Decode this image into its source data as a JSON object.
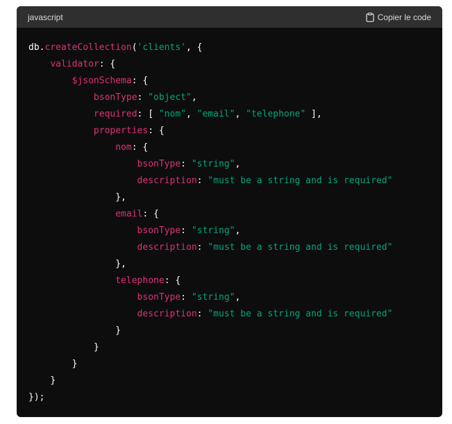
{
  "code_block": {
    "language": "javascript",
    "copy_label": "Copier le code",
    "colors": {
      "plain": "#ffffff",
      "keyword": "#df3079",
      "string": "#00a67d",
      "header_bg": "#2f2f2f",
      "body_bg": "#0d0d0d"
    },
    "lines": [
      [
        [
          "db.",
          "plain"
        ],
        [
          "createCollection",
          "keyword"
        ],
        [
          "(",
          "plain"
        ],
        [
          "'clients'",
          "string"
        ],
        [
          ", {",
          "plain"
        ]
      ],
      [
        [
          "    ",
          "plain"
        ],
        [
          "validator",
          "keyword"
        ],
        [
          ": {",
          "plain"
        ]
      ],
      [
        [
          "        ",
          "plain"
        ],
        [
          "$jsonSchema",
          "keyword"
        ],
        [
          ": {",
          "plain"
        ]
      ],
      [
        [
          "            ",
          "plain"
        ],
        [
          "bsonType",
          "keyword"
        ],
        [
          ": ",
          "plain"
        ],
        [
          "\"object\"",
          "string"
        ],
        [
          ",",
          "plain"
        ]
      ],
      [
        [
          "            ",
          "plain"
        ],
        [
          "required",
          "keyword"
        ],
        [
          ": [ ",
          "plain"
        ],
        [
          "\"nom\"",
          "string"
        ],
        [
          ", ",
          "plain"
        ],
        [
          "\"email\"",
          "string"
        ],
        [
          ", ",
          "plain"
        ],
        [
          "\"telephone\"",
          "string"
        ],
        [
          " ],",
          "plain"
        ]
      ],
      [
        [
          "            ",
          "plain"
        ],
        [
          "properties",
          "keyword"
        ],
        [
          ": {",
          "plain"
        ]
      ],
      [
        [
          "                ",
          "plain"
        ],
        [
          "nom",
          "keyword"
        ],
        [
          ": {",
          "plain"
        ]
      ],
      [
        [
          "                    ",
          "plain"
        ],
        [
          "bsonType",
          "keyword"
        ],
        [
          ": ",
          "plain"
        ],
        [
          "\"string\"",
          "string"
        ],
        [
          ",",
          "plain"
        ]
      ],
      [
        [
          "                    ",
          "plain"
        ],
        [
          "description",
          "keyword"
        ],
        [
          ": ",
          "plain"
        ],
        [
          "\"must be a string and is required\"",
          "string"
        ]
      ],
      [
        [
          "                ",
          "plain"
        ],
        [
          "},",
          "plain"
        ]
      ],
      [
        [
          "                ",
          "plain"
        ],
        [
          "email",
          "keyword"
        ],
        [
          ": {",
          "plain"
        ]
      ],
      [
        [
          "                    ",
          "plain"
        ],
        [
          "bsonType",
          "keyword"
        ],
        [
          ": ",
          "plain"
        ],
        [
          "\"string\"",
          "string"
        ],
        [
          ",",
          "plain"
        ]
      ],
      [
        [
          "                    ",
          "plain"
        ],
        [
          "description",
          "keyword"
        ],
        [
          ": ",
          "plain"
        ],
        [
          "\"must be a string and is required\"",
          "string"
        ]
      ],
      [
        [
          "                ",
          "plain"
        ],
        [
          "},",
          "plain"
        ]
      ],
      [
        [
          "                ",
          "plain"
        ],
        [
          "telephone",
          "keyword"
        ],
        [
          ": {",
          "plain"
        ]
      ],
      [
        [
          "                    ",
          "plain"
        ],
        [
          "bsonType",
          "keyword"
        ],
        [
          ": ",
          "plain"
        ],
        [
          "\"string\"",
          "string"
        ],
        [
          ",",
          "plain"
        ]
      ],
      [
        [
          "                    ",
          "plain"
        ],
        [
          "description",
          "keyword"
        ],
        [
          ": ",
          "plain"
        ],
        [
          "\"must be a string and is required\"",
          "string"
        ]
      ],
      [
        [
          "                ",
          "plain"
        ],
        [
          "}",
          "plain"
        ]
      ],
      [
        [
          "            ",
          "plain"
        ],
        [
          "}",
          "plain"
        ]
      ],
      [
        [
          "        ",
          "plain"
        ],
        [
          "}",
          "plain"
        ]
      ],
      [
        [
          "    ",
          "plain"
        ],
        [
          "}",
          "plain"
        ]
      ],
      [
        [
          "});",
          "plain"
        ]
      ]
    ]
  }
}
